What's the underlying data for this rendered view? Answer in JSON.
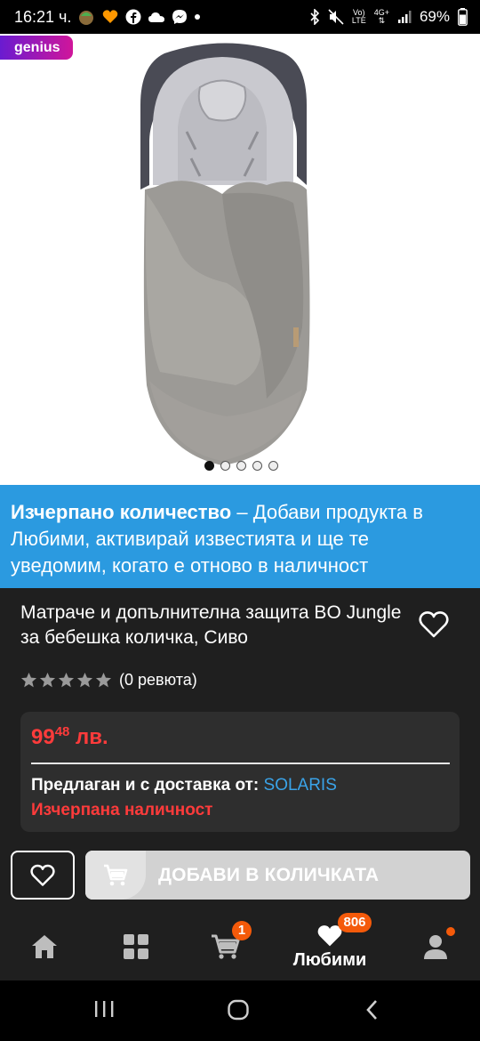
{
  "status_bar": {
    "time": "16:21 ч.",
    "battery": "69%",
    "network_top": "Vo)",
    "network_bottom": "LTE",
    "network2_top": "4G+",
    "icons": [
      "nature-app-icon",
      "heart-app-icon",
      "facebook-icon",
      "cloud-icon",
      "messenger-icon",
      "dot-icon",
      "bluetooth-icon",
      "mute-icon",
      "signal-icon",
      "battery-icon"
    ]
  },
  "product_image": {
    "badge": "genius",
    "dots_count": 5,
    "active_dot": 0,
    "alt": "grey baby stroller footmuff"
  },
  "banner": {
    "bold": "Изчерпано количество",
    "text": " – Добави продукта в Любими, активирай известията и ще те уведомим, когато е отново в наличност"
  },
  "product": {
    "title": "Матраче и допълнителна защита BO Jungle за бебешка количка, Сиво",
    "stars": 0,
    "reviews": "(0 ревюта)",
    "price_main": "99",
    "price_cents": "48",
    "price_currency": " лв.",
    "seller_prefix": "Предлаган и с доставка от: ",
    "seller_name": "SOLARIS",
    "stock": "Изчерпана наличност"
  },
  "actions": {
    "add_to_cart": "ДОБАВИ В КОЛИЧКАТА"
  },
  "bottom_nav": {
    "items": [
      {
        "name": "home",
        "label": ""
      },
      {
        "name": "categories",
        "label": ""
      },
      {
        "name": "cart",
        "label": "",
        "badge": "1"
      },
      {
        "name": "favorites",
        "label": "Любими",
        "badge": "806"
      },
      {
        "name": "account",
        "label": ""
      }
    ]
  },
  "colors": {
    "banner": "#2b9ae0",
    "price": "#ff3b3b",
    "badge": "#f45a0a",
    "seller": "#3aa3e8",
    "background": "#1f1f1f"
  }
}
